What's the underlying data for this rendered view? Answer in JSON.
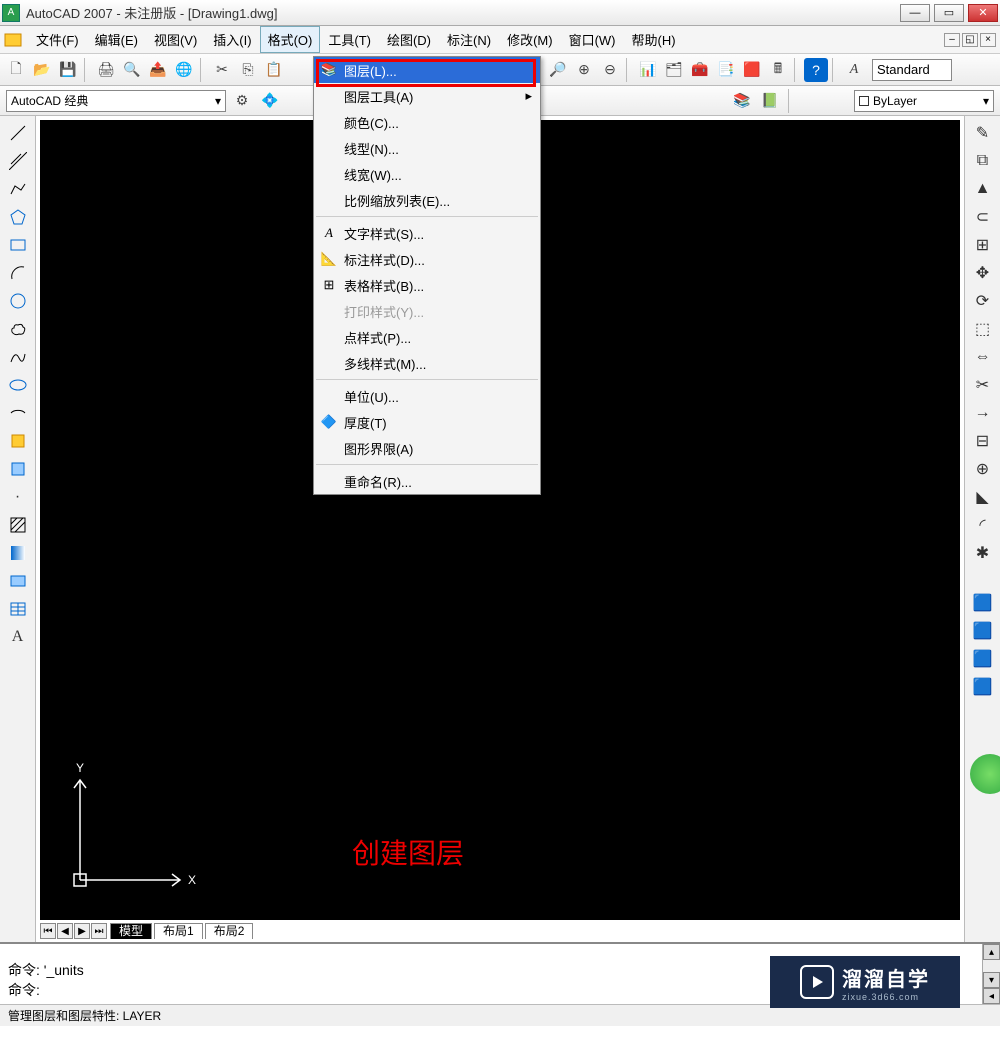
{
  "title": "AutoCAD 2007 - 未注册版 - [Drawing1.dwg]",
  "menu": {
    "file": "文件(F)",
    "edit": "编辑(E)",
    "view": "视图(V)",
    "insert": "插入(I)",
    "format": "格式(O)",
    "tools": "工具(T)",
    "draw": "绘图(D)",
    "dim": "标注(N)",
    "modify": "修改(M)",
    "window": "窗口(W)",
    "help": "帮助(H)"
  },
  "dropdown": {
    "layer": "图层(L)...",
    "layertool": "图层工具(A)",
    "color": "颜色(C)...",
    "linetype": "线型(N)...",
    "lineweight": "线宽(W)...",
    "scalelist": "比例缩放列表(E)...",
    "textstyle": "文字样式(S)...",
    "dimstyle": "标注样式(D)...",
    "tablestyle": "表格样式(B)...",
    "plotstyle": "打印样式(Y)...",
    "pointstyle": "点样式(P)...",
    "mlinestyle": "多线样式(M)...",
    "units": "单位(U)...",
    "thickness": "厚度(T)",
    "drawlimits": "图形界限(A)",
    "rename": "重命名(R)..."
  },
  "style_combo": "Standard",
  "workspace": "AutoCAD 经典",
  "bylayer": "ByLayer",
  "tabs": {
    "model": "模型",
    "layout1": "布局1",
    "layout2": "布局2"
  },
  "cmd": {
    "line1": "命令: '_units",
    "line2": "命令:"
  },
  "status": "管理图层和图层特性:    LAYER",
  "annotation": "创建图层",
  "watermark": {
    "title": "溜溜自学",
    "sub": "zixue.3d66.com"
  }
}
